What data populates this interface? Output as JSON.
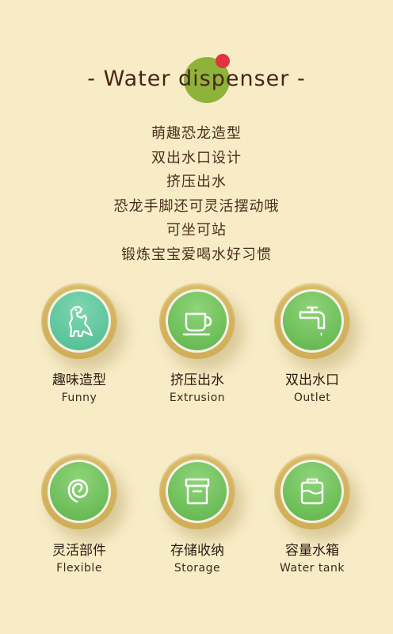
{
  "header": {
    "title": "- Water dispenser -"
  },
  "features": [
    "萌趣恐龙造型",
    "双出水口设计",
    "挤压出水",
    "恐龙手脚还可灵活摆动哦",
    "可坐可站",
    "锻炼宝宝爱喝水好习惯"
  ],
  "cards": [
    {
      "icon": "dinosaur-icon",
      "label_cn": "趣味造型",
      "label_en": "Funny"
    },
    {
      "icon": "cup-icon",
      "label_cn": "挤压出水",
      "label_en": "Extrusion"
    },
    {
      "icon": "faucet-icon",
      "label_cn": "双出水口",
      "label_en": "Outlet"
    },
    {
      "icon": "spiral-icon",
      "label_cn": "灵活部件",
      "label_en": "Flexible"
    },
    {
      "icon": "storage-box-icon",
      "label_cn": "存储收纳",
      "label_en": "Storage"
    },
    {
      "icon": "water-tank-icon",
      "label_cn": "容量水箱",
      "label_en": "Water tank"
    }
  ],
  "colors": {
    "background": "#f7ecc6",
    "accent_green": "#8db33a",
    "accent_red": "#e0343f",
    "badge_gold": "#d4b25c",
    "icon_green": "#6cbd58",
    "icon_teal": "#5bc49a"
  }
}
